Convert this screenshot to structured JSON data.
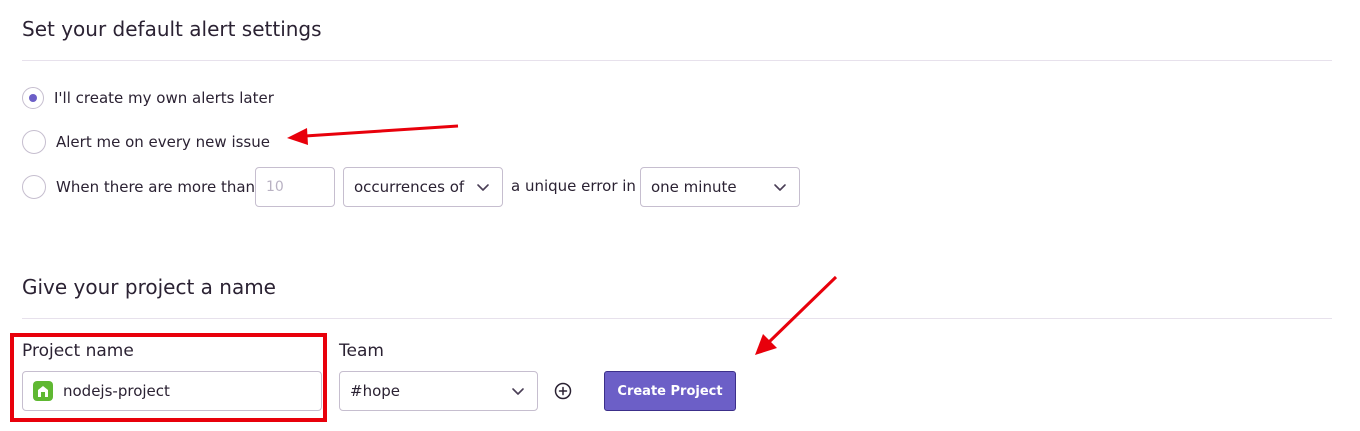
{
  "alerts": {
    "title": "Set your default alert settings",
    "options": [
      {
        "label": "I'll create my own alerts later",
        "selected": true
      },
      {
        "label": "Alert me on every new issue",
        "selected": false
      },
      {
        "label": "When there are more than",
        "selected": false
      }
    ],
    "threshold_placeholder": "10",
    "metric_select": "occurrences of",
    "connector_text": "a unique error in",
    "interval_select": "one minute"
  },
  "project": {
    "title": "Give your project a name",
    "name_label": "Project name",
    "name_value": "nodejs-project",
    "team_label": "Team",
    "team_value": "#hope",
    "create_button": "Create Project"
  },
  "colors": {
    "accent": "#6c5fc7",
    "annotation_red": "#e8000b",
    "platform_icon": "#5fb832"
  },
  "icons": {
    "chevron": "chevron-down-icon",
    "add_team": "plus-circle-icon",
    "platform": "nodejs-platform-icon"
  }
}
